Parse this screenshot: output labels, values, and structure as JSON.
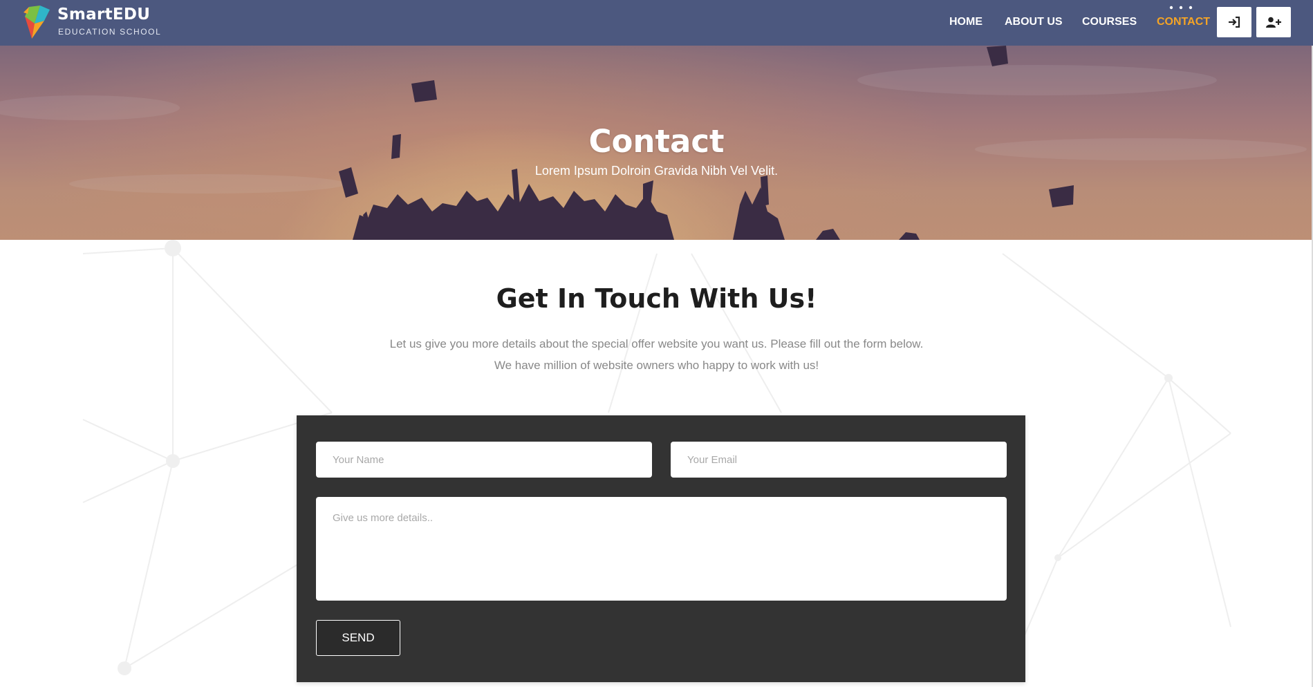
{
  "brand": {
    "name": "SmartEDU",
    "tagline": "EDUCATION SCHOOL"
  },
  "nav": {
    "items": [
      {
        "label": "HOME",
        "active": false
      },
      {
        "label": "ABOUT US",
        "active": false
      },
      {
        "label": "COURSES",
        "active": false
      },
      {
        "label": "CONTACT",
        "active": true
      }
    ],
    "login_icon": "sign-in-icon",
    "register_icon": "user-plus-icon",
    "active_color": "#f5a425",
    "bar_color": "#4c587f"
  },
  "hero": {
    "title": "Contact",
    "subtitle": "Lorem Ipsum Dolroin Gravida Nibh Vel Velit."
  },
  "section": {
    "heading": "Get In Touch With Us!",
    "description_line1": "Let us give you more details about the special offer website you want us. Please fill out the form below.",
    "description_line2": "We have million of website owners who happy to work with us!"
  },
  "form": {
    "name_placeholder": "Your Name",
    "name_value": "",
    "email_placeholder": "Your Email",
    "email_value": "",
    "details_placeholder": "Give us more details..",
    "details_value": "",
    "send_label": "SEND",
    "panel_color": "#333333"
  }
}
